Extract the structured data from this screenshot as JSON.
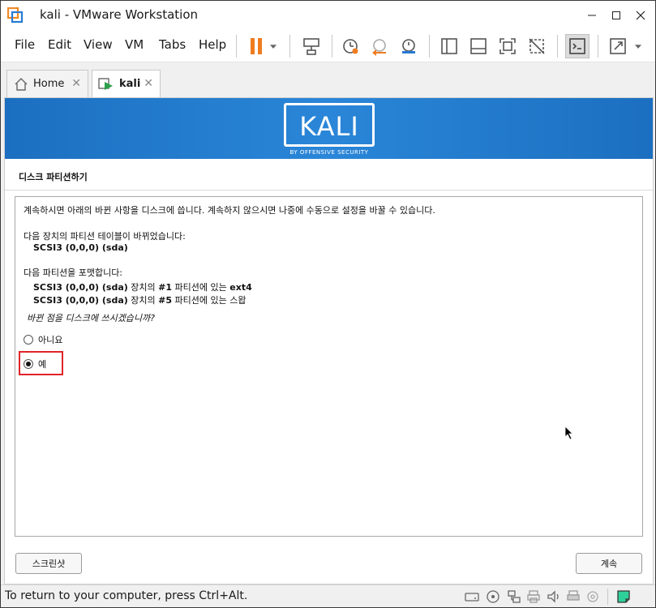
{
  "window": {
    "title": "kali - VMware Workstation"
  },
  "menu": {
    "items": [
      "File",
      "Edit",
      "View",
      "VM",
      "Tabs",
      "Help"
    ]
  },
  "tabs": [
    {
      "label": "Home"
    },
    {
      "label": "kali"
    }
  ],
  "banner": {
    "logo_text": "KALI",
    "logo_subtext": "BY OFFENSIVE SECURITY",
    "color": "#2a86d8"
  },
  "installer": {
    "title": "디스크 파티션하기",
    "intro": "계속하시면 아래의 바뀐 사항을 디스크에 씁니다. 계속하지 않으시면 나중에 수동으로 설정을 바꿀 수 있습니다.",
    "table_changed_label": "다음 장치의 파티션 테이블이 바뀌었습니다:",
    "table_changed_device": "SCSI3 (0,0,0) (sda)",
    "format_label": "다음 파티션을 포맷합니다:",
    "format_items": [
      {
        "device": "SCSI3 (0,0,0) (sda)",
        "mid1": " 장치의 ",
        "part": "#1",
        "mid2": " 파티션에 있는 ",
        "fs": "ext4"
      },
      {
        "device": "SCSI3 (0,0,0) (sda)",
        "mid1": " 장치의 ",
        "part": "#5",
        "mid2": " 파티션에 있는 ",
        "fs": "스왑"
      }
    ],
    "question": "바뀐 점을 디스크에 쓰시겠습니까?",
    "options": [
      {
        "label": "아니요",
        "checked": false
      },
      {
        "label": "예",
        "checked": true
      }
    ],
    "screenshot_button": "스크린샷",
    "continue_button": "계속",
    "highlight_color": "#e0242a"
  },
  "statusbar": {
    "message": "To return to your computer, press Ctrl+Alt."
  }
}
